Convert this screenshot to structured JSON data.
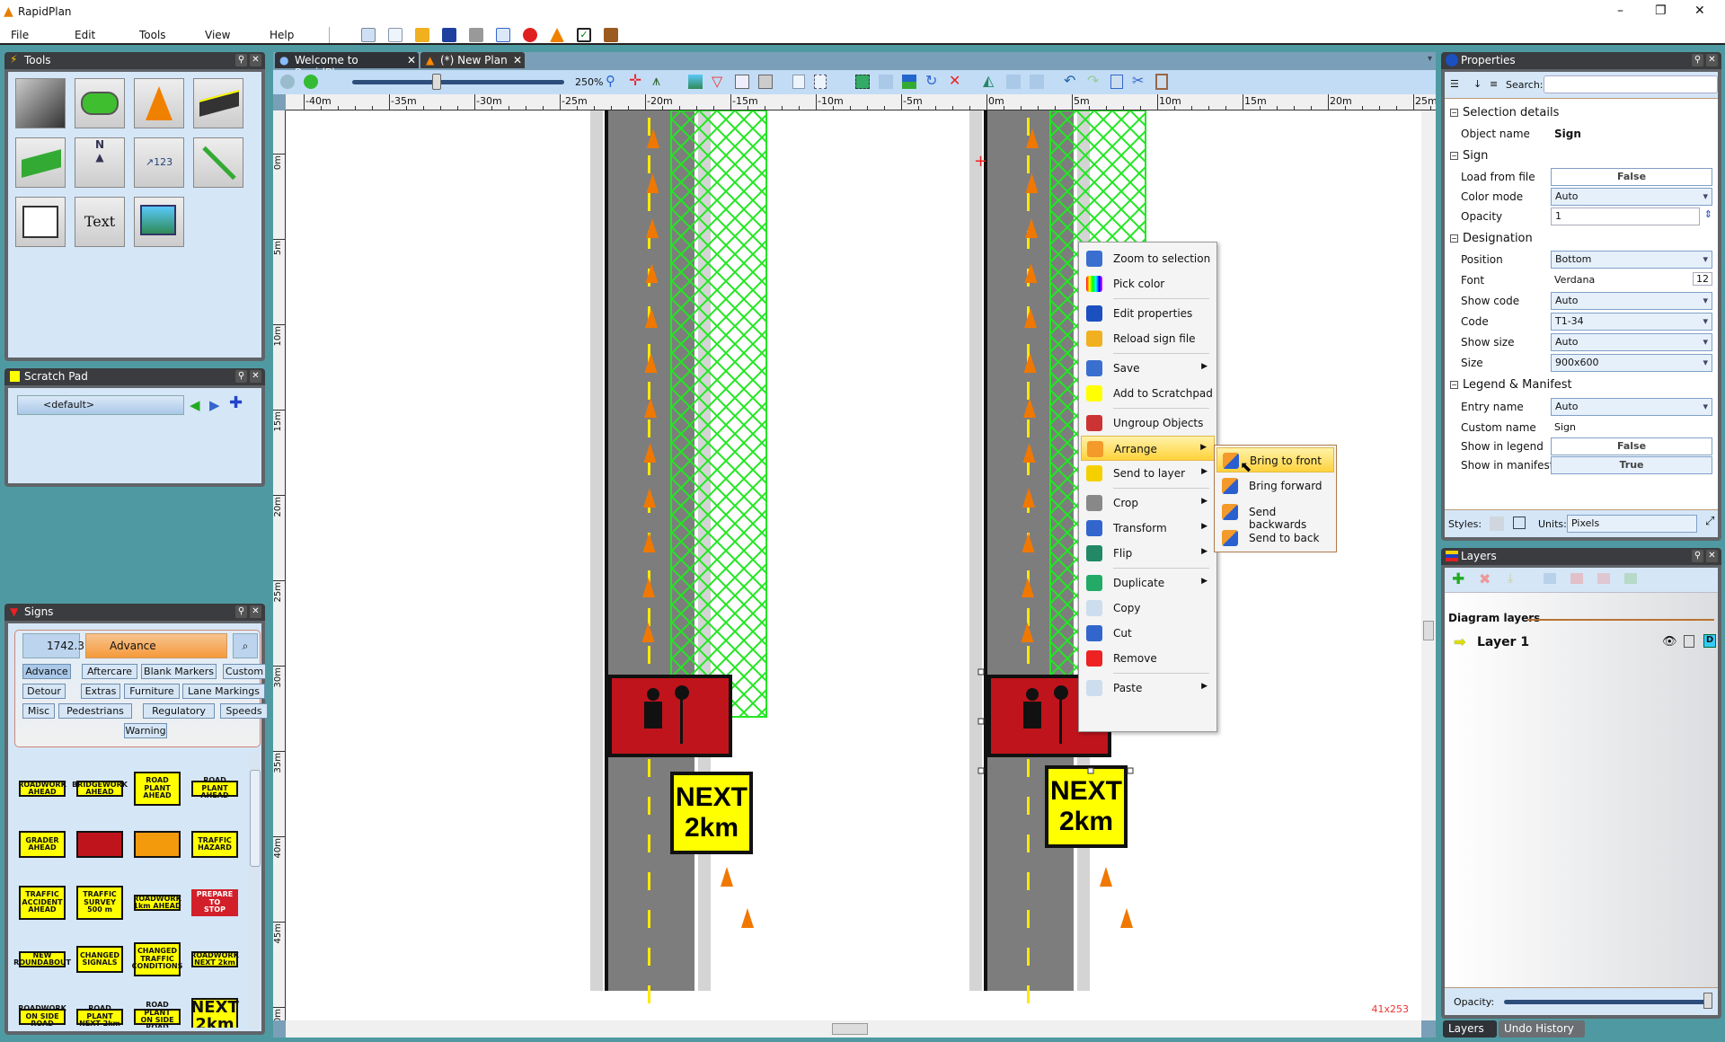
{
  "app": {
    "title": "RapidPlan"
  },
  "menu": [
    "File",
    "Edit",
    "Tools",
    "View",
    "Help"
  ],
  "tools_panel": {
    "title": "Tools",
    "text_tool": "Text"
  },
  "scratch_pad": {
    "title": "Scratch Pad",
    "selected": "<default>"
  },
  "signs_panel": {
    "title": "Signs",
    "version": "1742.3",
    "category": "Advance",
    "tabs": [
      "Advance",
      "Aftercare",
      "Blank Markers",
      "Custom",
      "Detour",
      "Extras",
      "Furniture",
      "Lane Markings",
      "Misc",
      "Pedestrians",
      "Regulatory",
      "Speeds",
      "Warning"
    ],
    "signs": [
      "ROADWORK\nAHEAD",
      "BRIDGEWORK\nAHEAD",
      "ROAD\nPLANT\nAHEAD",
      "ROAD PLANT\nAHEAD",
      "GRADER\nAHEAD",
      "",
      "",
      "TRAFFIC\nHAZARD",
      "TRAFFIC\nACCIDENT\nAHEAD",
      "TRAFFIC\nSURVEY\n500 m",
      "ROADWORK\n1km AHEAD",
      "PREPARE\nTO\nSTOP",
      "NEW\nROUNDABOUT",
      "CHANGED\nSIGNALS",
      "CHANGED\nTRAFFIC\nCONDITIONS",
      "ROADWORK\nNEXT 2km",
      "ROADWORK\nON SIDE ROAD",
      "ROAD PLANT\nNEXT 2km",
      "ROAD PLANT\nON SIDE ROAD",
      "NEXT\n2km"
    ]
  },
  "document_tabs": [
    {
      "label": "Welcome to RapidPlan"
    },
    {
      "label": "(*) New Plan"
    }
  ],
  "toolbar": {
    "zoom": "250%",
    "zoom_slider_fraction": 0.4
  },
  "ruler": {
    "h_labels": [
      "-40m",
      "-35m",
      "-30m",
      "-25m",
      "-20m",
      "-15m",
      "-10m",
      "-5m",
      "0m",
      "5m",
      "10m",
      "15m",
      "20m",
      "25m"
    ],
    "v_labels": [
      "0m",
      "5m",
      "10m",
      "15m",
      "20m",
      "25m",
      "30m",
      "35m",
      "40m",
      "45m",
      "50m"
    ]
  },
  "canvas": {
    "sign_text": "NEXT\n2km",
    "status": "41x253"
  },
  "context_menu": {
    "items": [
      "Zoom to selection",
      "Pick color",
      "Edit properties",
      "Reload sign file",
      "Save",
      "Add to Scratchpad",
      "Ungroup Objects",
      "Arrange",
      "Send to layer",
      "Crop",
      "Transform",
      "Flip",
      "Duplicate",
      "Copy",
      "Cut",
      "Remove",
      "Paste"
    ],
    "submenu": [
      "Bring to front",
      "Bring forward",
      "Send backwards",
      "Send to back"
    ]
  },
  "properties": {
    "title": "Properties",
    "search_label": "Search:",
    "search_value": "",
    "sections": {
      "selection": "Selection details",
      "sign": "Sign",
      "designation": "Designation",
      "legend": "Legend & Manifest"
    },
    "rows": {
      "object_name": [
        "Object name",
        "Sign"
      ],
      "load_from_file": [
        "Load from file",
        "False"
      ],
      "color_mode": [
        "Color mode",
        "Auto"
      ],
      "opacity": [
        "Opacity",
        "1"
      ],
      "position": [
        "Position",
        "Bottom"
      ],
      "font": [
        "Font",
        "Verdana"
      ],
      "font_size": "12",
      "show_code": [
        "Show code",
        "Auto"
      ],
      "code": [
        "Code",
        "T1-34"
      ],
      "show_size": [
        "Show size",
        "Auto"
      ],
      "size": [
        "Size",
        "900x600"
      ],
      "entry_name": [
        "Entry name",
        "Auto"
      ],
      "custom_name": [
        "Custom name",
        "Sign"
      ],
      "show_in_legend": [
        "Show in legend",
        "False"
      ],
      "show_in_manifest": [
        "Show in manifest",
        "True"
      ]
    },
    "styles_label": "Styles:",
    "units_label": "Units:",
    "units_value": "Pixels"
  },
  "layers": {
    "title": "Layers",
    "group_label": "Diagram layers",
    "items": [
      "Layer 1"
    ],
    "opacity_label": "Opacity:",
    "opacity": 1.0,
    "bottom_tabs": [
      "Layers",
      "Undo History"
    ]
  }
}
